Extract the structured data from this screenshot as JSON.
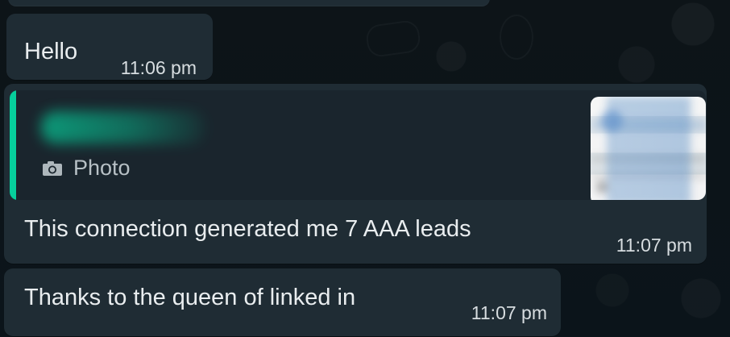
{
  "chat": {
    "messages": [
      {
        "text": "Hello",
        "time": "11:06 pm"
      },
      {
        "reply_preview": {
          "label": "Photo",
          "icon": "camera-icon"
        },
        "text": "This connection generated me 7 AAA leads",
        "time": "11:07 pm"
      },
      {
        "text": "Thanks to the queen of linked in",
        "time": "11:07 pm"
      }
    ]
  },
  "colors": {
    "background": "#0b141a",
    "bubble": "#1f2c34",
    "reply_box": "#1a252d",
    "accent": "#06cf9c",
    "text": "#e9edef",
    "subtext": "#b7c0c5"
  }
}
